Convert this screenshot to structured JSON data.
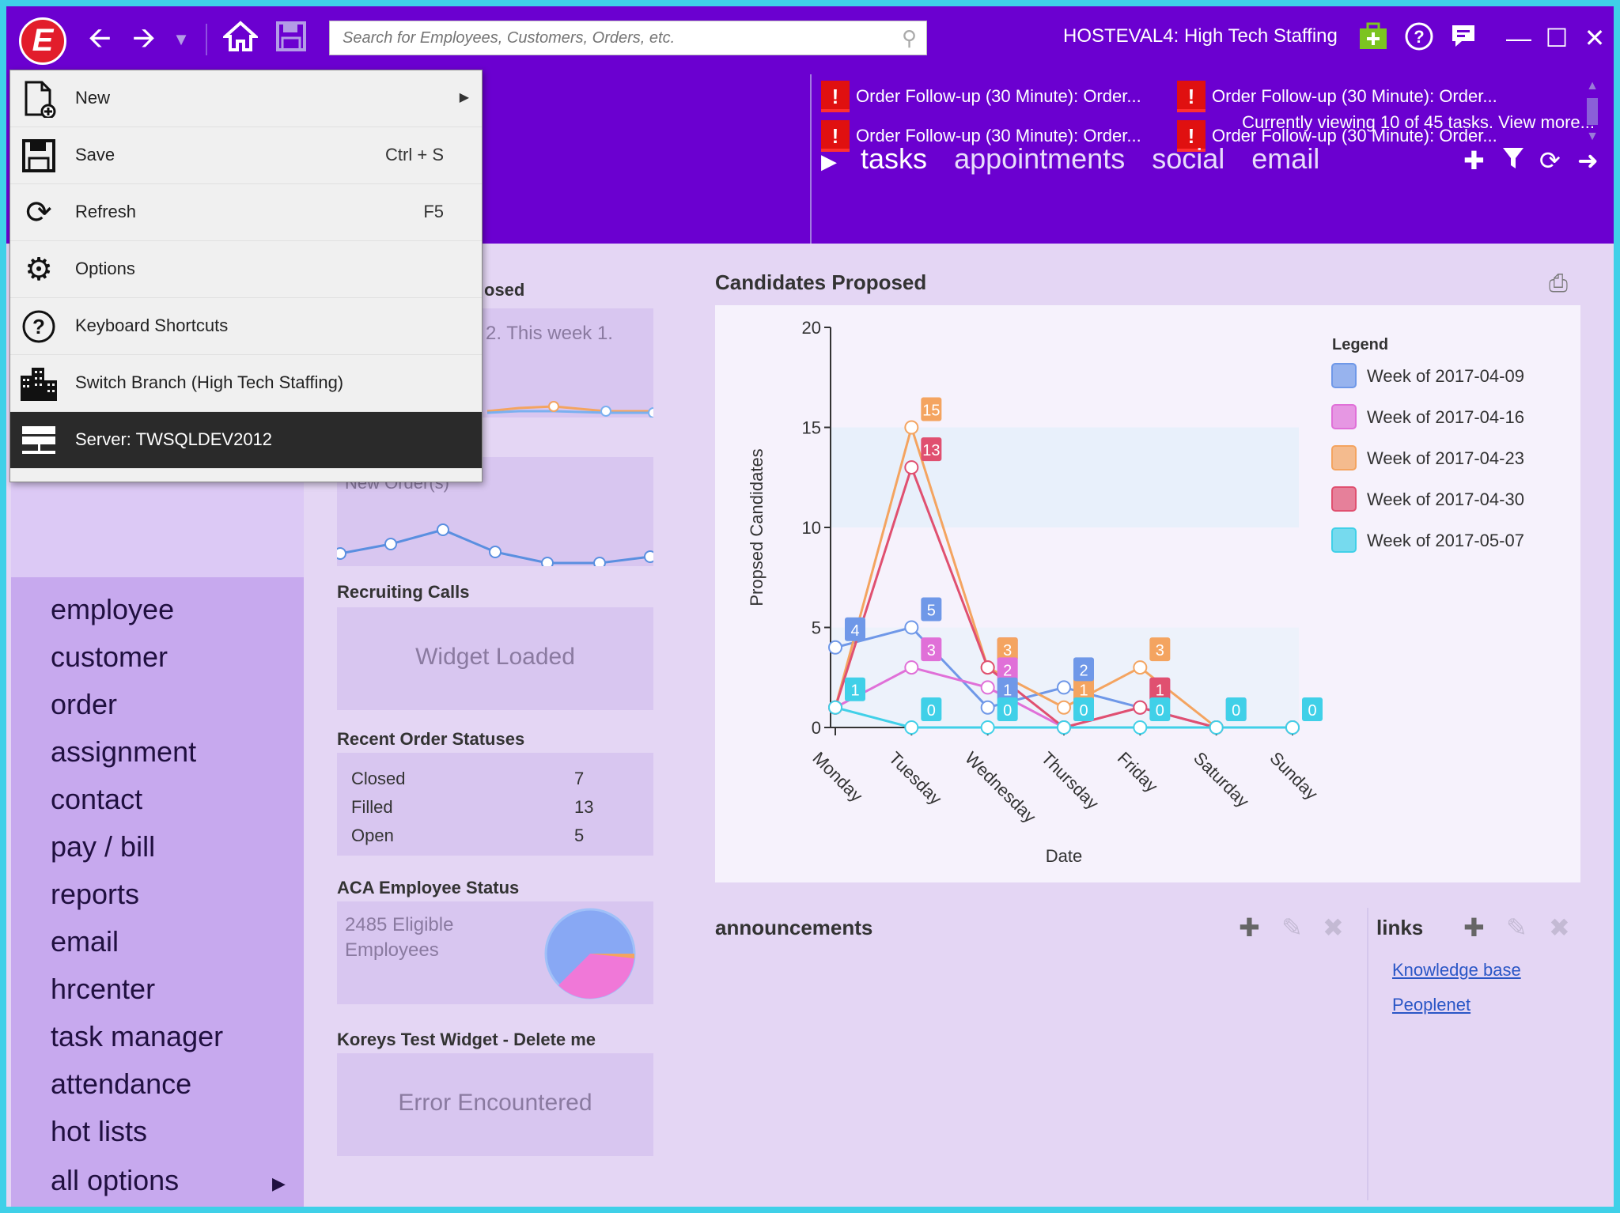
{
  "titlebar": {
    "logo_letter": "E",
    "search_placeholder": "Search for Employees, Customers, Orders, etc.",
    "window_title": "HOSTEVAL4: High Tech Staffing",
    "icons": [
      "back-arrow-icon",
      "forward-arrow-icon",
      "dropdown-icon",
      "home-icon",
      "save-icon",
      "search-icon",
      "add-case-icon",
      "help-icon",
      "feedback-icon",
      "minimize-icon",
      "maximize-icon",
      "close-icon"
    ]
  },
  "menu": {
    "items": [
      {
        "label": "New",
        "shortcut": "",
        "submenu": true,
        "icon": "new-document-icon"
      },
      {
        "label": "Save",
        "shortcut": "Ctrl + S",
        "submenu": false,
        "icon": "save-icon"
      },
      {
        "label": "Refresh",
        "shortcut": "F5",
        "submenu": false,
        "icon": "refresh-icon"
      },
      {
        "label": "Options",
        "shortcut": "",
        "submenu": false,
        "icon": "gear-icon"
      },
      {
        "label": "Keyboard Shortcuts",
        "shortcut": "",
        "submenu": false,
        "icon": "help-icon"
      },
      {
        "label": "Switch Branch (High Tech Staffing)",
        "shortcut": "",
        "submenu": false,
        "icon": "building-icon"
      },
      {
        "label": "Server: TWSQLDEV2012",
        "shortcut": "",
        "submenu": false,
        "icon": "server-icon"
      }
    ]
  },
  "tasks": {
    "items": [
      "Order Follow-up (30 Minute): Order...",
      "Order Follow-up (30 Minute): Order...",
      "Order Follow-up (30 Minute): Order...",
      "Order Follow-up (30 Minute): Order..."
    ],
    "view_more": "Currently viewing 10 of 45 tasks. View more...",
    "tabs": [
      "tasks",
      "appointments",
      "social",
      "email"
    ]
  },
  "nav": {
    "items": [
      "employee",
      "customer",
      "order",
      "assignment",
      "contact",
      "pay / bill",
      "reports",
      "email",
      "hrcenter",
      "task manager",
      "attendance",
      "hot lists",
      "all options"
    ]
  },
  "widgets": {
    "proposed_title_fragment": "osed",
    "proposed_text_fragment": "2. This week 1.",
    "new_orders_fragment": "New Order(s)",
    "recruiting_title": "Recruiting Calls",
    "recruiting_msg": "Widget Loaded",
    "statuses_title": "Recent Order Statuses",
    "statuses": [
      {
        "label": "Closed",
        "value": "7"
      },
      {
        "label": "Filled",
        "value": "13"
      },
      {
        "label": "Open",
        "value": "5"
      }
    ],
    "aca_title": "ACA Employee Status",
    "aca_text": "2485 Eligible Employees",
    "koreys_title": "Koreys Test Widget - Delete me",
    "koreys_msg": "Error Encountered"
  },
  "chart_title": "Candidates Proposed",
  "chart_data": {
    "type": "line",
    "xlabel": "Date",
    "ylabel": "Propsed Candidates",
    "ylim": [
      0,
      20
    ],
    "yticks": [
      0,
      5,
      10,
      15,
      20
    ],
    "categories": [
      "Monday",
      "Tuesday",
      "Wednesday",
      "Thursday",
      "Friday",
      "Saturday",
      "Sunday"
    ],
    "legend_title": "Legend",
    "series": [
      {
        "name": "Week of 2017-04-09",
        "color": "#6f98e8",
        "values": [
          4,
          5,
          1,
          2,
          1,
          0,
          0
        ]
      },
      {
        "name": "Week of 2017-04-16",
        "color": "#e070d8",
        "values": [
          1,
          3,
          2,
          0,
          1,
          0,
          0
        ]
      },
      {
        "name": "Week of 2017-04-23",
        "color": "#f4a460",
        "values": [
          1,
          15,
          3,
          1,
          3,
          0,
          0
        ]
      },
      {
        "name": "Week of 2017-04-30",
        "color": "#e05070",
        "values": [
          1,
          13,
          3,
          0,
          1,
          0,
          0
        ]
      },
      {
        "name": "Week of 2017-05-07",
        "color": "#40d0e8",
        "values": [
          1,
          0,
          0,
          0,
          0,
          0,
          0
        ]
      }
    ],
    "labels": [
      {
        "series": 0,
        "x": 0,
        "y": 4
      },
      {
        "series": 4,
        "x": 0,
        "y": 1
      },
      {
        "series": 2,
        "x": 1,
        "y": 15
      },
      {
        "series": 3,
        "x": 1,
        "y": 13
      },
      {
        "series": 0,
        "x": 1,
        "y": 5
      },
      {
        "series": 1,
        "x": 1,
        "y": 3
      },
      {
        "series": 4,
        "x": 1,
        "y": 0
      },
      {
        "series": 3,
        "x": 2,
        "y": 3
      },
      {
        "series": 2,
        "x": 2,
        "y": 3
      },
      {
        "series": 1,
        "x": 2,
        "y": 2
      },
      {
        "series": 0,
        "x": 2,
        "y": 1
      },
      {
        "series": 4,
        "x": 2,
        "y": 0
      },
      {
        "series": 2,
        "x": 3,
        "y": 1
      },
      {
        "series": 0,
        "x": 3,
        "y": 2
      },
      {
        "series": 1,
        "x": 3,
        "y": 0
      },
      {
        "series": 4,
        "x": 3,
        "y": 0
      },
      {
        "series": 1,
        "x": 4,
        "y": 1
      },
      {
        "series": 2,
        "x": 4,
        "y": 3
      },
      {
        "series": 3,
        "x": 4,
        "y": 1
      },
      {
        "series": 4,
        "x": 4,
        "y": 0
      },
      {
        "series": 1,
        "x": 5,
        "y": 0
      },
      {
        "series": 4,
        "x": 5,
        "y": 0
      },
      {
        "series": 4,
        "x": 6,
        "y": 0
      }
    ]
  },
  "announcements": {
    "title": "announcements"
  },
  "links": {
    "title": "links",
    "items": [
      "Knowledge base",
      "Peoplenet"
    ]
  }
}
